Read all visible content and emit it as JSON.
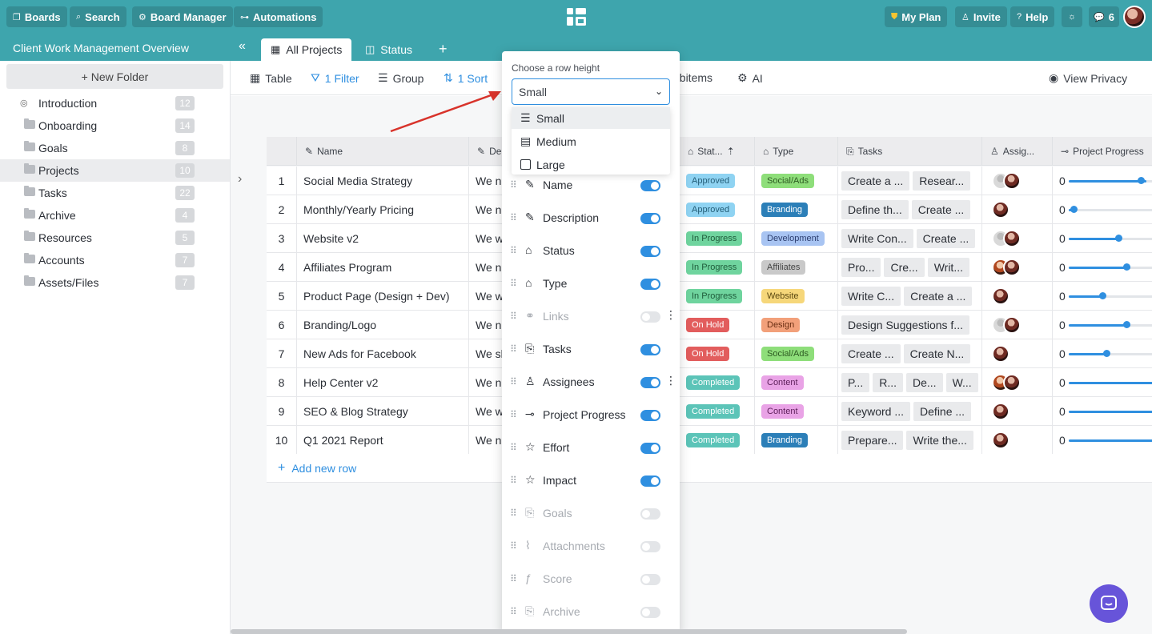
{
  "topbar": {
    "boards": "Boards",
    "search": "Search",
    "board_manager": "Board Manager",
    "automations": "Automations",
    "my_plan": "My Plan",
    "invite": "Invite",
    "help": "Help",
    "notifications_count": "6"
  },
  "subbar": {
    "project_title": "Client Work Management Overview",
    "tabs": [
      {
        "label": "All Projects"
      },
      {
        "label": "Status"
      }
    ]
  },
  "sidebar": {
    "new_folder": "+ New Folder",
    "items": [
      {
        "label": "Introduction",
        "count": "12"
      },
      {
        "label": "Onboarding",
        "count": "14"
      },
      {
        "label": "Goals",
        "count": "8"
      },
      {
        "label": "Projects",
        "count": "10"
      },
      {
        "label": "Tasks",
        "count": "22"
      },
      {
        "label": "Archive",
        "count": "4"
      },
      {
        "label": "Resources",
        "count": "5"
      },
      {
        "label": "Accounts",
        "count": "7"
      },
      {
        "label": "Assets/Files",
        "count": "7"
      }
    ]
  },
  "toolbar": {
    "table": "Table",
    "filter": "1 Filter",
    "group": "Group",
    "sort": "1 Sort",
    "subitems": "ubitems",
    "ai": "AI",
    "view_privacy": "View Privacy"
  },
  "grid": {
    "headers": {
      "name": "Name",
      "desc": "De",
      "status": "Stat...",
      "type": "Type",
      "tasks": "Tasks",
      "assignees": "Assig...",
      "progress": "Project Progress"
    },
    "rows": [
      {
        "n": "1",
        "name": "Social Media Strategy",
        "desc": "We n",
        "status": "Approved",
        "type": "Social/Ads",
        "tasks": [
          "Create a ...",
          "Resear..."
        ],
        "progress": "0",
        "pct": 0.88
      },
      {
        "n": "2",
        "name": "Monthly/Yearly Pricing",
        "desc": "We n",
        "status": "Approved",
        "type": "Branding",
        "tasks": [
          "Define th...",
          "Create ..."
        ],
        "progress": "0",
        "pct": 0.04
      },
      {
        "n": "3",
        "name": "Website v2",
        "desc": "We w",
        "status": "In Progress",
        "type": "Development",
        "tasks": [
          "Write Con...",
          "Create ..."
        ],
        "progress": "0",
        "pct": 0.6
      },
      {
        "n": "4",
        "name": "Affiliates Program",
        "desc": "We n",
        "status": "In Progress",
        "type": "Affiliates",
        "tasks": [
          "Pro...",
          "Cre...",
          "Writ..."
        ],
        "progress": "0",
        "pct": 0.7
      },
      {
        "n": "5",
        "name": "Product Page (Design + Dev)",
        "desc": "We w",
        "status": "In Progress",
        "type": "Website",
        "tasks": [
          "Write C...",
          "Create a ..."
        ],
        "progress": "0",
        "pct": 0.4
      },
      {
        "n": "6",
        "name": "Branding/Logo",
        "desc": "We n",
        "status": "On Hold",
        "type": "Design",
        "tasks": [
          "Design Suggestions f..."
        ],
        "progress": "0",
        "pct": 0.7
      },
      {
        "n": "7",
        "name": "New Ads for Facebook",
        "desc": "We sl",
        "status": "On Hold",
        "type": "Social/Ads",
        "tasks": [
          "Create ...",
          "Create N..."
        ],
        "progress": "0",
        "pct": 0.45
      },
      {
        "n": "8",
        "name": "Help Center v2",
        "desc": "We n",
        "status": "Completed",
        "type": "Content",
        "tasks": [
          "P...",
          "R...",
          "De...",
          "W..."
        ],
        "progress": "0",
        "pct": 1.0
      },
      {
        "n": "9",
        "name": "SEO & Blog Strategy",
        "desc": "We w",
        "status": "Completed",
        "type": "Content",
        "tasks": [
          "Keyword ...",
          "Define ..."
        ],
        "progress": "0",
        "pct": 1.0
      },
      {
        "n": "10",
        "name": "Q1 2021 Report",
        "desc": "We n",
        "status": "Completed",
        "type": "Branding",
        "tasks": [
          "Prepare...",
          "Write the..."
        ],
        "progress": "0",
        "pct": 1.0
      }
    ],
    "add_row": "Add new row"
  },
  "panel": {
    "label": "Choose a row height",
    "selected": "Small",
    "options": [
      "Small",
      "Medium",
      "Large"
    ],
    "fields": [
      {
        "label": "Name",
        "on": true
      },
      {
        "label": "Description",
        "on": true
      },
      {
        "label": "Status",
        "on": true
      },
      {
        "label": "Type",
        "on": true
      },
      {
        "label": "Links",
        "on": false
      },
      {
        "label": "Tasks",
        "on": true
      },
      {
        "label": "Assignees",
        "on": true
      },
      {
        "label": "Project Progress",
        "on": true
      },
      {
        "label": "Effort",
        "on": true
      },
      {
        "label": "Impact",
        "on": true
      },
      {
        "label": "Goals",
        "on": false
      },
      {
        "label": "Attachments",
        "on": false
      },
      {
        "label": "Score",
        "on": false
      },
      {
        "label": "Archive",
        "on": false
      }
    ]
  },
  "colors": {
    "brand": "#3ea5ad",
    "accent": "#2f8fe0",
    "approved": "#8fd3f2",
    "in_progress": "#6fd49e",
    "on_hold": "#e25d5d",
    "completed": "#5cc4b8"
  }
}
